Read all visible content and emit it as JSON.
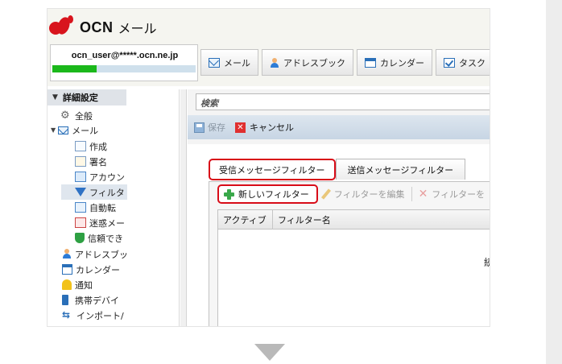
{
  "brand": {
    "name": "OCN",
    "product": "メール",
    "logo_color": "#d8141d"
  },
  "account": {
    "email": "ocn_user@*****.ocn.ne.jp",
    "quota_used_fraction": 0.31
  },
  "nav": {
    "tabs": [
      {
        "label": "メール",
        "icon": "mail-icon"
      },
      {
        "label": "アドレスブック",
        "icon": "person-icon"
      },
      {
        "label": "カレンダー",
        "icon": "calendar-icon"
      },
      {
        "label": "タスク",
        "icon": "task-checkbox-icon"
      }
    ]
  },
  "sidebar": {
    "title": "詳細設定",
    "items": [
      {
        "label": "全般",
        "icon": "gear-icon"
      },
      {
        "label": "メール",
        "icon": "mail-icon"
      },
      {
        "label": "作成",
        "icon": "compose-icon"
      },
      {
        "label": "署名",
        "icon": "signature-icon"
      },
      {
        "label": "アカウン",
        "icon": "account-icon"
      },
      {
        "label": "フィルタ",
        "icon": "filter-funnel-icon"
      },
      {
        "label": "自動転",
        "icon": "auto-forward-icon"
      },
      {
        "label": "迷惑メー",
        "icon": "spam-icon"
      },
      {
        "label": "信頼でき",
        "icon": "trusted-shield-icon"
      },
      {
        "label": "アドレスブッ",
        "icon": "person-icon"
      },
      {
        "label": "カレンダー",
        "icon": "calendar-icon"
      },
      {
        "label": "通知",
        "icon": "bell-icon"
      },
      {
        "label": "携帯デバイ",
        "icon": "mobile-device-icon"
      },
      {
        "label": "インポート/",
        "icon": "import-export-icon"
      }
    ]
  },
  "search": {
    "placeholder": "検索"
  },
  "actions": {
    "save_label": "保存",
    "cancel_label": "キャンセル"
  },
  "filter_tabs": [
    {
      "label": "受信メッセージフィルター",
      "active": true
    },
    {
      "label": "送信メッセージフィルター",
      "active": false
    }
  ],
  "toolbar": {
    "new_label": "新しいフィルター",
    "edit_label": "フィルターを編集",
    "delete_label": "フィルターを"
  },
  "table": {
    "columns": [
      "アクティブ",
      "フィルター名"
    ],
    "empty_text": "続"
  },
  "colors": {
    "highlight": "#d80c18",
    "quota_bar": "#1bb81b",
    "action_bar": "#c7d5e4"
  }
}
